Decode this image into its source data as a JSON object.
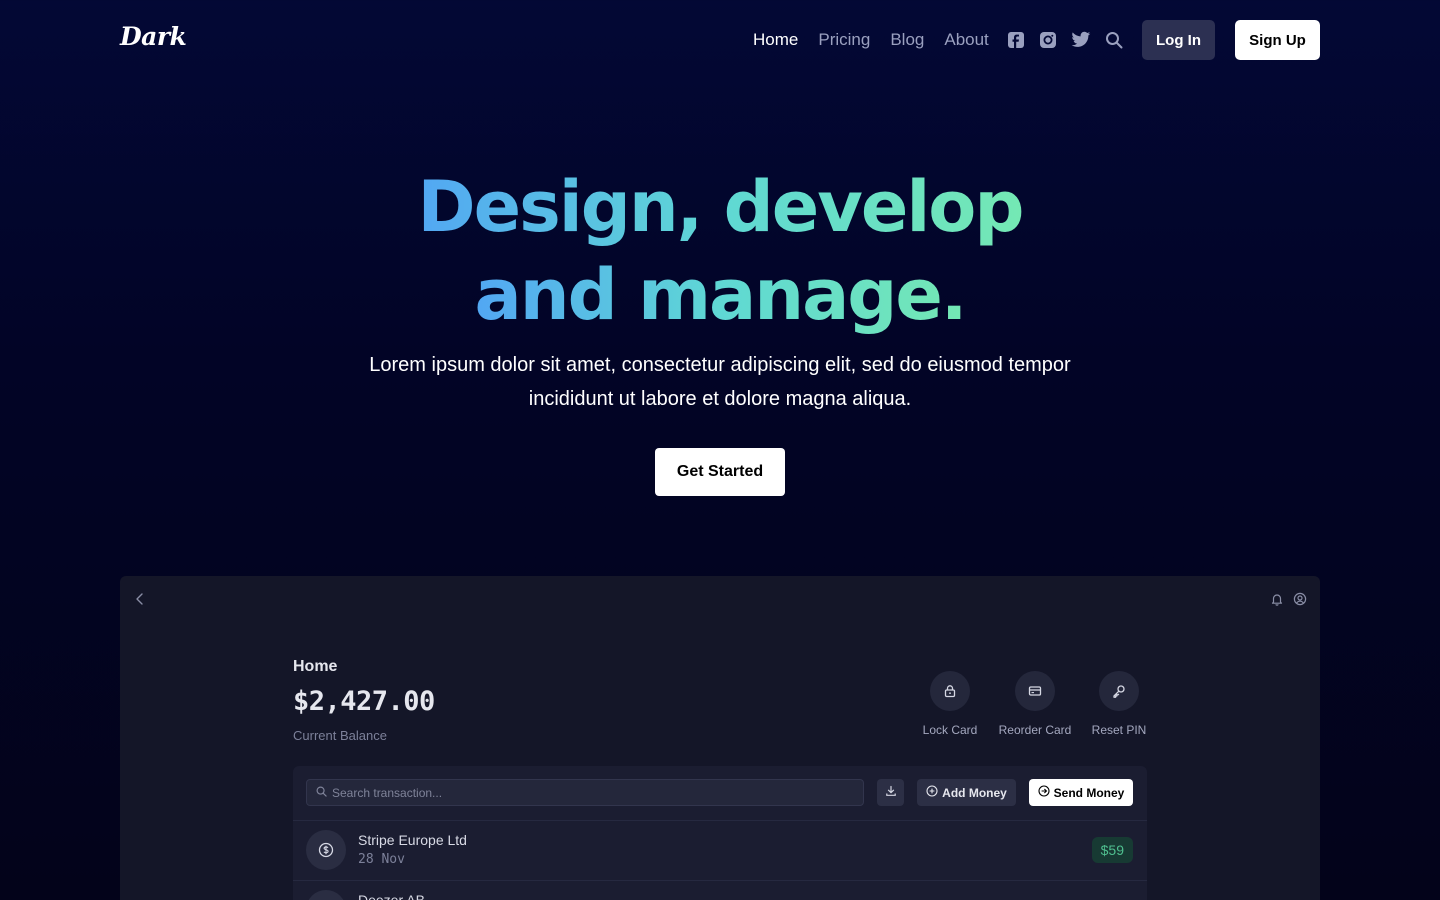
{
  "nav": {
    "logo": "Dark",
    "links": [
      "Home",
      "Pricing",
      "Blog",
      "About"
    ],
    "login_label": "Log In",
    "signup_label": "Sign Up"
  },
  "hero": {
    "title_line1": "Design, develop",
    "title_line2": "and manage.",
    "subtitle": "Lorem ipsum dolor sit amet, consectetur adipiscing elit, sed do eiusmod tempor incididunt ut labore et dolore magna aliqua.",
    "cta_label": "Get Started",
    "gradient_colors": [
      "#52a7f3",
      "#5fd8d4",
      "#74e8b4"
    ]
  },
  "app": {
    "title": "Home",
    "balance": "$2,427.00",
    "balance_label": "Current Balance",
    "actions": [
      "Lock Card",
      "Reorder Card",
      "Reset PIN"
    ],
    "search_placeholder": "Search transaction...",
    "add_money_label": "Add Money",
    "send_money_label": "Send Money",
    "transactions": [
      {
        "name": "Stripe Europe Ltd",
        "date": "28 Nov",
        "amount": "$59"
      },
      {
        "name": "Deezer AB",
        "date": "",
        "amount": ""
      }
    ]
  },
  "colors": {
    "background": "#020426",
    "app_surface": "#141628",
    "panel": "#1b1d31",
    "positive_amount": "#4fbf8f"
  }
}
